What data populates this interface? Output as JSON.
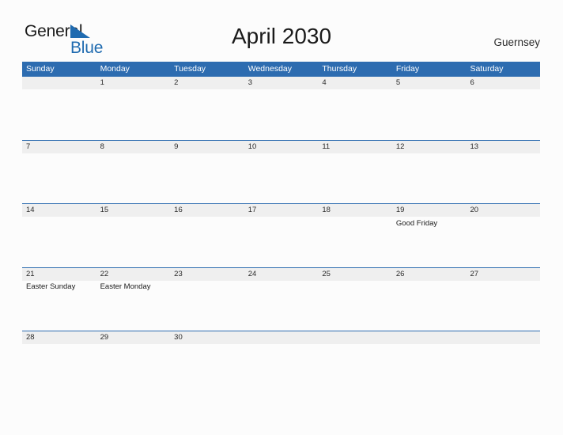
{
  "brand": {
    "name_part1": "General",
    "name_part2": "Blue",
    "flag_icon": "blue-triangle-flag-icon",
    "color_dark": "#1a1a1a",
    "color_blue": "#1f6bb0"
  },
  "header": {
    "title": "April 2030",
    "region": "Guernsey"
  },
  "theme": {
    "header_bar": "#2d6cb0",
    "row_band": "#efefef",
    "separator": "#2d6cb0",
    "page_background": "#fcfcfc",
    "text": "#2a2a2a"
  },
  "weekdays": [
    "Sunday",
    "Monday",
    "Tuesday",
    "Wednesday",
    "Thursday",
    "Friday",
    "Saturday"
  ],
  "weeks": [
    [
      {
        "date": "",
        "event": ""
      },
      {
        "date": "1",
        "event": ""
      },
      {
        "date": "2",
        "event": ""
      },
      {
        "date": "3",
        "event": ""
      },
      {
        "date": "4",
        "event": ""
      },
      {
        "date": "5",
        "event": ""
      },
      {
        "date": "6",
        "event": ""
      }
    ],
    [
      {
        "date": "7",
        "event": ""
      },
      {
        "date": "8",
        "event": ""
      },
      {
        "date": "9",
        "event": ""
      },
      {
        "date": "10",
        "event": ""
      },
      {
        "date": "11",
        "event": ""
      },
      {
        "date": "12",
        "event": ""
      },
      {
        "date": "13",
        "event": ""
      }
    ],
    [
      {
        "date": "14",
        "event": ""
      },
      {
        "date": "15",
        "event": ""
      },
      {
        "date": "16",
        "event": ""
      },
      {
        "date": "17",
        "event": ""
      },
      {
        "date": "18",
        "event": ""
      },
      {
        "date": "19",
        "event": "Good Friday"
      },
      {
        "date": "20",
        "event": ""
      }
    ],
    [
      {
        "date": "21",
        "event": "Easter Sunday"
      },
      {
        "date": "22",
        "event": "Easter Monday"
      },
      {
        "date": "23",
        "event": ""
      },
      {
        "date": "24",
        "event": ""
      },
      {
        "date": "25",
        "event": ""
      },
      {
        "date": "26",
        "event": ""
      },
      {
        "date": "27",
        "event": ""
      }
    ],
    [
      {
        "date": "28",
        "event": ""
      },
      {
        "date": "29",
        "event": ""
      },
      {
        "date": "30",
        "event": ""
      },
      {
        "date": "",
        "event": ""
      },
      {
        "date": "",
        "event": ""
      },
      {
        "date": "",
        "event": ""
      },
      {
        "date": "",
        "event": ""
      }
    ]
  ]
}
